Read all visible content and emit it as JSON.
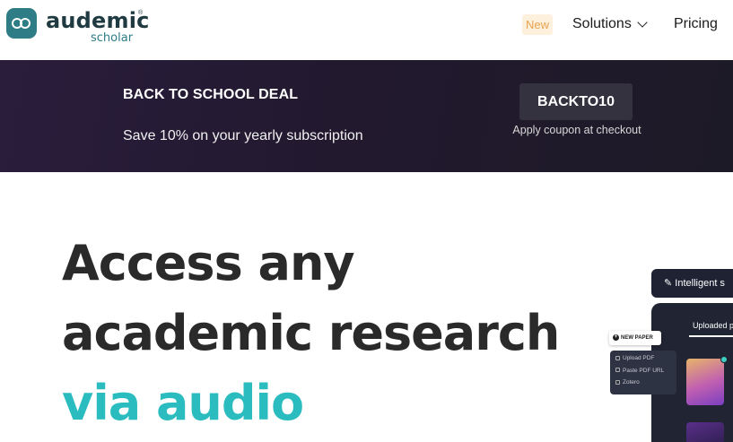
{
  "brand": {
    "name": "audemic",
    "registered": "®",
    "sub": "scholar"
  },
  "nav": {
    "badge": "New",
    "solutions": "Solutions",
    "pricing": "Pricing"
  },
  "promo": {
    "title": "BACK TO SCHOOL DEAL",
    "subtitle": "Save 10% on your yearly subscription",
    "coupon_code": "BACKTO10",
    "coupon_note": "Apply coupon at checkout"
  },
  "hero": {
    "line1": "Access any",
    "line2": "academic research",
    "line3": "via audio"
  },
  "mockup": {
    "pill_label": "Intelligent s",
    "tab_label": "Uploaded pa",
    "new_paper": "NEW PAPER",
    "menu": [
      "Upload PDF",
      "Paste PDF URL",
      "Zotero"
    ]
  },
  "colors": {
    "accent": "#2bbcc0",
    "brand": "#2d7c86",
    "banner": "#22192f",
    "badge_bg": "#fdf0dd",
    "badge_text": "#e8a44e"
  },
  "icons": {
    "logo": "audemic-logo-icon",
    "chevron": "chevron-down-icon",
    "magic": "magic-wand-icon",
    "plus": "plus-icon"
  }
}
